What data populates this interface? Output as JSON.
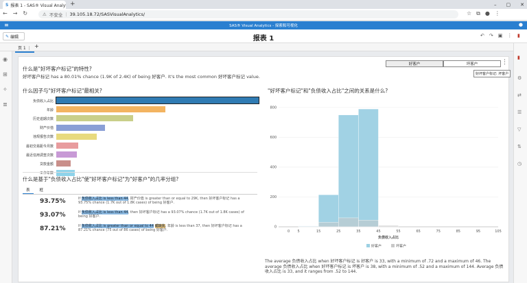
{
  "browser": {
    "tab_title": "报表 1 - SAS® Visual Analytics",
    "security_label": "不安全",
    "url": "39.105.18.72/SASVisualAnalytics/"
  },
  "app": {
    "header_title": "SAS® Visual Analytics - 探索和可视化",
    "edit_label": "编辑",
    "report_title": "报表 1",
    "page_tab": "页 1"
  },
  "question1": {
    "title": "什么是\"好坏客户标记\"的特性?",
    "answer": "好坏客户标记 has a 80.01% chance (1.9K of 2.4K) of being 好客户. It's the most common 好坏客户标记 value."
  },
  "target_selector": {
    "options": [
      "好客户",
      "坏客户"
    ],
    "selected": "好客户",
    "tooltip": "好坏客户标记: 坏客户"
  },
  "factors": {
    "title": "什么因子与\"好坏客户标记\"最相关?",
    "items": [
      {
        "label": "负债收入占比",
        "value": 1.0,
        "color": "#2f7bb3"
      },
      {
        "label": "年龄",
        "value": 0.54,
        "color": "#f3b461"
      },
      {
        "label": "历史逾期次数",
        "value": 0.38,
        "color": "#c9cf8a"
      },
      {
        "label": "财产价值",
        "value": 0.24,
        "color": "#8a9fd6"
      },
      {
        "label": "违规报告次数",
        "value": 0.2,
        "color": "#e8da7e"
      },
      {
        "label": "最初交易距今月数",
        "value": 0.11,
        "color": "#e89c9e"
      },
      {
        "label": "最近信用调查次数",
        "value": 0.1,
        "color": "#c89ad6"
      },
      {
        "label": "贷款金额",
        "value": 0.07,
        "color": "#c98f8a"
      },
      {
        "label": "工作年数",
        "value": 0.09,
        "color": "#8ed3ea"
      }
    ]
  },
  "groups": {
    "title": "什么是基于\"负债收入占比\"使\"好坏客户标记\"为\"好客户\"的几率分组?",
    "tabs": [
      "表",
      "框"
    ],
    "rows": [
      {
        "pct": "93.75%",
        "rule_pre": "If ",
        "rule_hl": "负债收入占比 is less than 44",
        "rule_post": ", 财产价值 is greater than or equal to 29K, then 好坏客户标记 has a 93.75% chance (1.7K out of 1.8K cases) of being 好客户."
      },
      {
        "pct": "93.07%",
        "rule_pre": "If ",
        "rule_hl": "负债收入占比 is less than 44",
        "rule_post": ", then 好坏客户标记 has a 93.07% chance (1.7K out of 1.8K cases) of being 好客户."
      },
      {
        "pct": "87.21%",
        "rule_pre": "If ",
        "rule_hl": "负债收入占比 is greater than or equal to 44",
        "rule_hl2": "或缺失",
        "rule_post": ", 年龄 is less than 37, then 好坏客户标记 has a 87.21% chance (75 out of 86 cases) of being 好客户."
      }
    ]
  },
  "relation": {
    "title": "\"好坏客户标记\"和\"负债收入占比\"之间的关系是什么?",
    "summary": "The average 负债收入占比 when 好坏客户标记 is 好客户 is 33, with a minimum of .72 and a maximum of 46. The average 负债收入占比 when 好坏客户标记 is 坏客户 is 38, with a minimum of .52 and a maximum of 144. Average 负债收入占比 is 33, and it ranges from .52 to 144."
  },
  "chart_data": {
    "type": "bar",
    "xlabel": "负债收入占比",
    "ylabel": "",
    "x_ticks": [
      0,
      5,
      15,
      25,
      35,
      45,
      55,
      65,
      75,
      85,
      95,
      105
    ],
    "y_ticks": [
      0,
      200,
      400,
      600,
      800
    ],
    "ylim": [
      0,
      850
    ],
    "xlim": [
      -5,
      105
    ],
    "bin_width": 10,
    "legend": [
      "好客户",
      "坏客户"
    ],
    "legend_position": "bottom",
    "series": [
      {
        "name": "好客户",
        "color": "#9cd0e3",
        "bins": [
          {
            "x": 10,
            "y": 5
          },
          {
            "x": 20,
            "y": 215
          },
          {
            "x": 30,
            "y": 750
          },
          {
            "x": 40,
            "y": 790
          }
        ]
      },
      {
        "name": "坏客户",
        "color": "#c8c8c8",
        "bins": [
          {
            "x": 10,
            "y": 3
          },
          {
            "x": 20,
            "y": 30
          },
          {
            "x": 30,
            "y": 60
          },
          {
            "x": 40,
            "y": 45
          },
          {
            "x": 50,
            "y": 10
          }
        ]
      }
    ]
  }
}
